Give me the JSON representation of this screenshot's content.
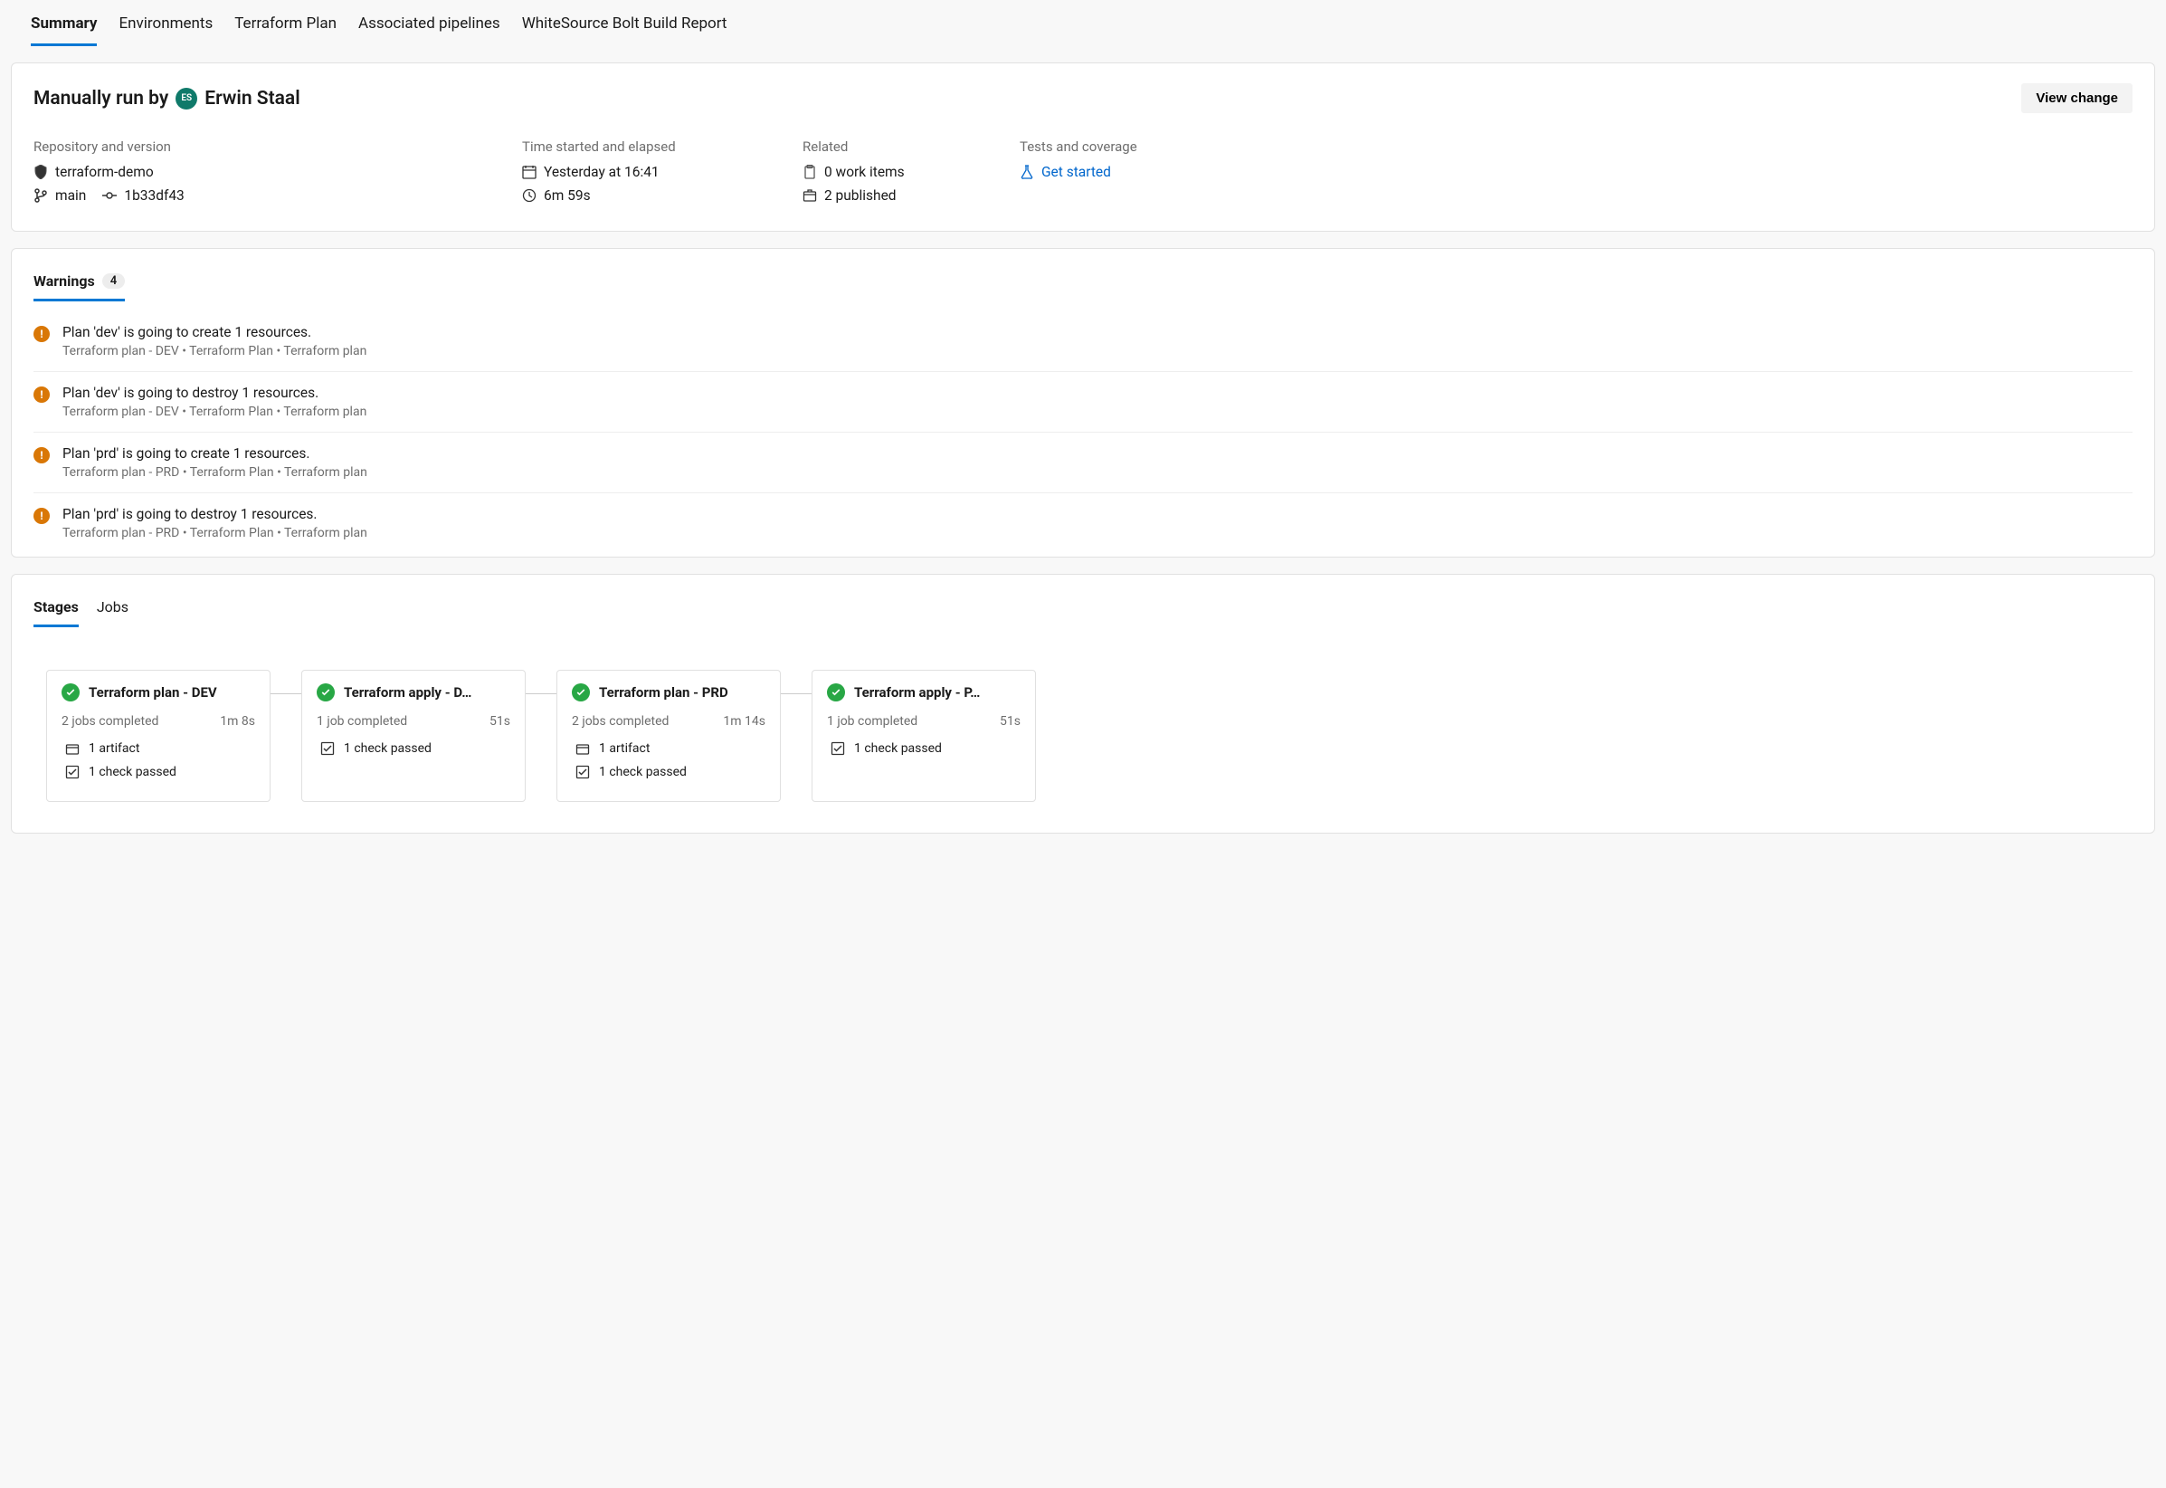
{
  "top_tabs": [
    "Summary",
    "Environments",
    "Terraform Plan",
    "Associated pipelines",
    "WhiteSource Bolt Build Report"
  ],
  "top_tab_active": 0,
  "summary": {
    "title_prefix": "Manually run by",
    "avatar_initials": "ES",
    "user": "Erwin Staal",
    "view_change_btn": "View change",
    "cols": {
      "repo": {
        "label": "Repository and version",
        "repo_name": "terraform-demo",
        "branch": "main",
        "commit": "1b33df43"
      },
      "time": {
        "label": "Time started and elapsed",
        "started": "Yesterday at 16:41",
        "elapsed": "6m 59s"
      },
      "related": {
        "label": "Related",
        "work_items": "0 work items",
        "published": "2 published"
      },
      "tests": {
        "label": "Tests and coverage",
        "link": "Get started"
      }
    }
  },
  "warnings": {
    "tab_label": "Warnings",
    "count": "4",
    "items": [
      {
        "msg": "Plan 'dev' is going to create 1 resources.",
        "src": "Terraform plan - DEV  •  Terraform Plan  •  Terraform plan"
      },
      {
        "msg": "Plan 'dev' is going to destroy 1 resources.",
        "src": "Terraform plan - DEV  •  Terraform Plan  •  Terraform plan"
      },
      {
        "msg": "Plan 'prd' is going to create 1 resources.",
        "src": "Terraform plan - PRD  •  Terraform Plan  •  Terraform plan"
      },
      {
        "msg": "Plan 'prd' is going to destroy 1 resources.",
        "src": "Terraform plan - PRD  •  Terraform Plan  •  Terraform plan"
      }
    ]
  },
  "stages_section": {
    "tabs": [
      "Stages",
      "Jobs"
    ],
    "active": 0,
    "stages": [
      {
        "title": "Terraform plan - DEV",
        "jobs": "2 jobs completed",
        "dur": "1m 8s",
        "artifact": "1 artifact",
        "check": "1 check passed"
      },
      {
        "title": "Terraform apply - D…",
        "jobs": "1 job completed",
        "dur": "51s",
        "artifact": "",
        "check": "1 check passed"
      },
      {
        "title": "Terraform plan - PRD",
        "jobs": "2 jobs completed",
        "dur": "1m 14s",
        "artifact": "1 artifact",
        "check": "1 check passed"
      },
      {
        "title": "Terraform apply - P…",
        "jobs": "1 job completed",
        "dur": "51s",
        "artifact": "",
        "check": "1 check passed"
      }
    ]
  }
}
